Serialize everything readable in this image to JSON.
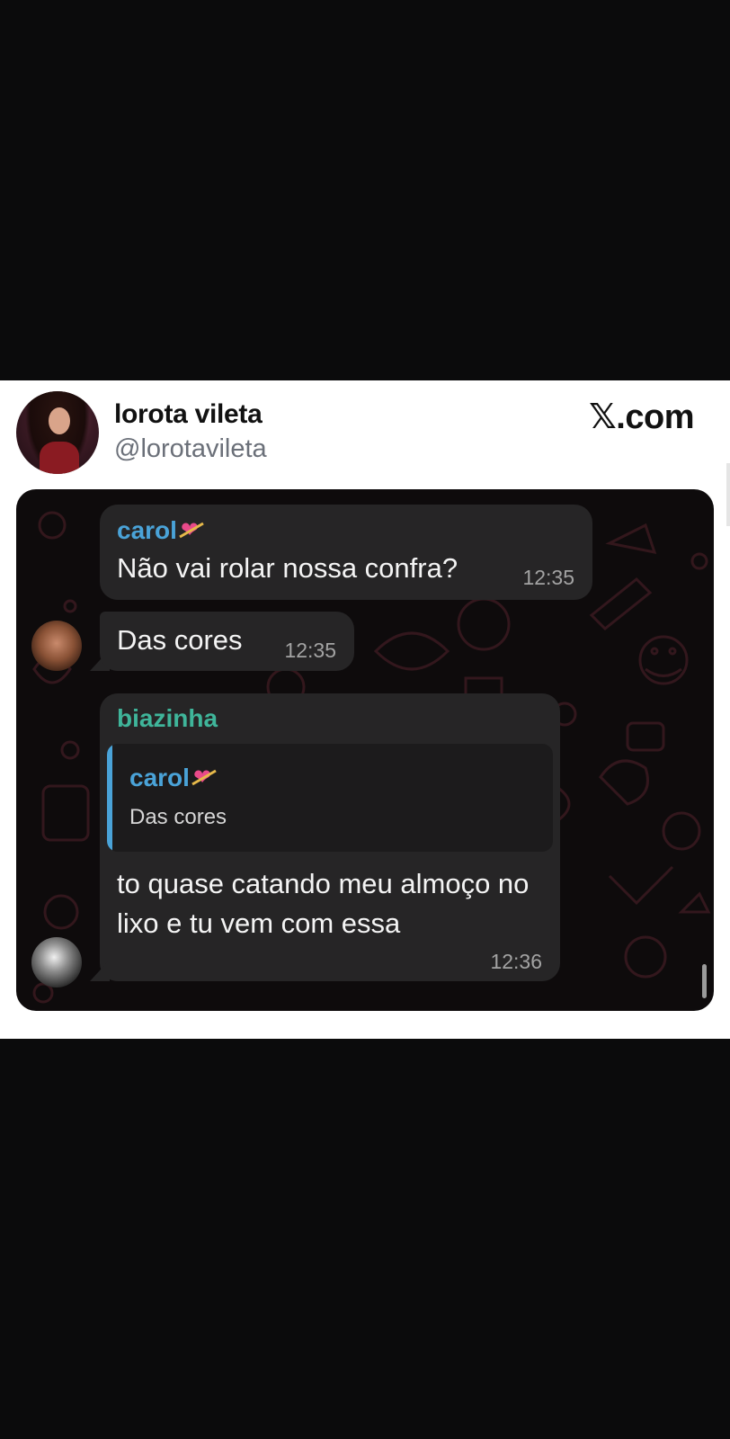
{
  "post": {
    "author_name": "lorota vileta",
    "author_handle": "@lorotavileta",
    "source_label": ".com",
    "source_mark": "𝕏"
  },
  "chat": {
    "messages": [
      {
        "sender": "carol",
        "sender_emoji": "heart-with-arrow-icon",
        "text": "Não vai rolar nossa confra?",
        "time": "12:35"
      },
      {
        "text": "Das cores",
        "time": "12:35"
      },
      {
        "sender": "biazinha",
        "reply_to": {
          "sender": "carol",
          "text": "Das cores"
        },
        "text": "to quase catando meu almoço no lixo e tu vem com essa",
        "time": "12:36"
      }
    ]
  },
  "colors": {
    "page_background": "#0b0b0c",
    "card_background": "#ffffff",
    "chat_background": "#0e0b0c",
    "bubble": "#262526",
    "sender_carol": "#4aa3d8",
    "sender_biazinha": "#3fb59a",
    "heart": "#e94a8a"
  }
}
